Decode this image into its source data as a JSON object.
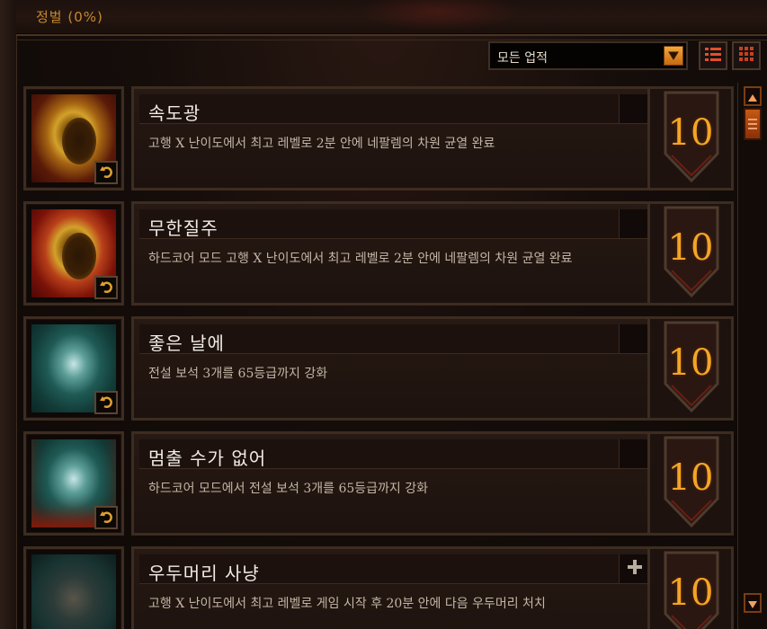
{
  "header": {
    "title": "정벌 (0%)"
  },
  "filter": {
    "selected": "모든 업적"
  },
  "view_buttons": {
    "list": "list-view-icon",
    "grid": "grid-view-icon"
  },
  "achievements": [
    {
      "title": "속도광",
      "description": "고행 X 난이도에서 최고 레벨로 2분 안에 네팔렘의 차원 균열 완료",
      "points": "10",
      "icon": "gold-egg",
      "reset_icon": "undo-icon"
    },
    {
      "title": "무한질주",
      "description": "하드코어 모드 고행 X 난이도에서 최고 레벨로 2분 안에 네팔렘의 차원 균열 완료",
      "points": "10",
      "icon": "gold-egg-red",
      "reset_icon": "undo-icon"
    },
    {
      "title": "좋은 날에",
      "description": "전설 보석 3개를 65등급까지 강화",
      "points": "10",
      "icon": "teal-gems",
      "reset_icon": "undo-icon"
    },
    {
      "title": "멈출 수가 없어",
      "description": "하드코어 모드에서 전설 보석 3개를 65등급까지 강화",
      "points": "10",
      "icon": "teal-gems-red",
      "reset_icon": "undo-icon"
    },
    {
      "title": "우두머리 사냥",
      "description": "고행 X 난이도에서 최고 레벨로 게임 시작 후 20분 안에 다음 우두머리 처치",
      "points": "10",
      "icon": "demon-head",
      "title_icon": "cross-icon"
    }
  ],
  "colors": {
    "accent": "#f4a526",
    "header_text": "#c7892e",
    "title_text": "#f1ebe2",
    "desc_text": "#c3b6a6"
  }
}
